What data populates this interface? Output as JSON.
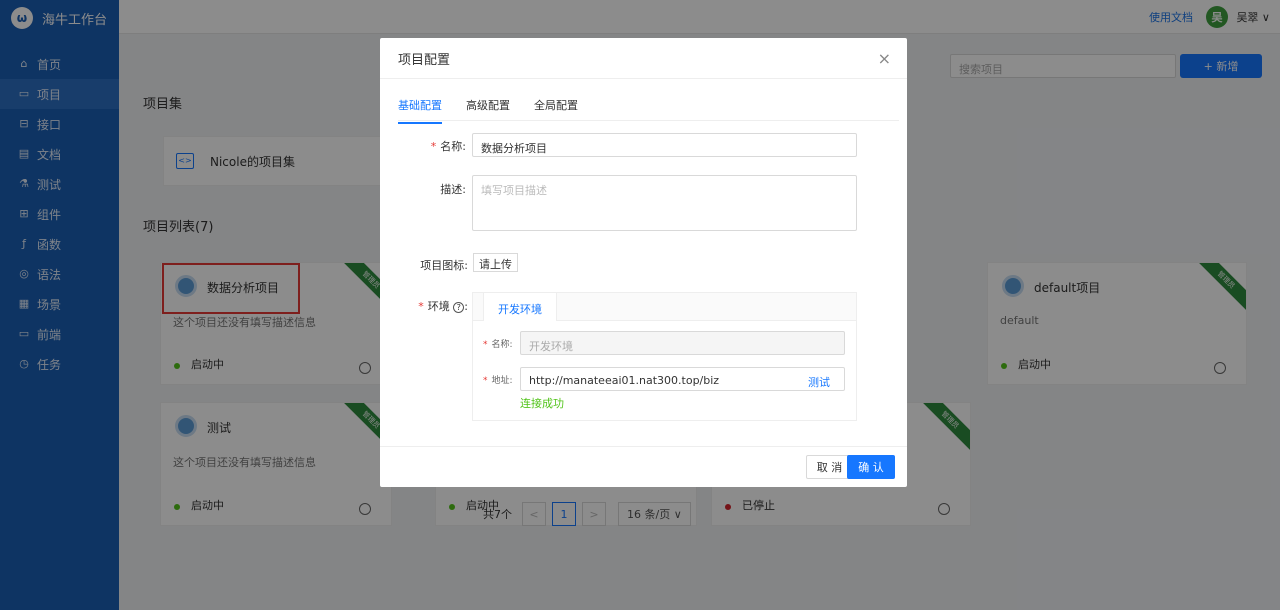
{
  "app": {
    "title": "海牛工作台",
    "logo": "ω"
  },
  "sidebar": {
    "items": [
      {
        "label": "首页",
        "icon": "home-icon",
        "glyph": "⌂",
        "active": false
      },
      {
        "label": "项目",
        "icon": "project-icon",
        "glyph": "▭",
        "active": true
      },
      {
        "label": "接口",
        "icon": "api-icon",
        "glyph": "⊟",
        "active": false
      },
      {
        "label": "文档",
        "icon": "doc-icon",
        "glyph": "▤",
        "active": false
      },
      {
        "label": "测试",
        "icon": "test-icon",
        "glyph": "⚗",
        "active": false
      },
      {
        "label": "组件",
        "icon": "component-icon",
        "glyph": "⊞",
        "active": false
      },
      {
        "label": "函数",
        "icon": "function-icon",
        "glyph": "ƒ",
        "active": false
      },
      {
        "label": "语法",
        "icon": "syntax-icon",
        "glyph": "◎",
        "active": false
      },
      {
        "label": "场景",
        "icon": "scene-icon",
        "glyph": "▦",
        "active": false
      },
      {
        "label": "前端",
        "icon": "frontend-icon",
        "glyph": "▭",
        "active": false
      },
      {
        "label": "任务",
        "icon": "task-icon",
        "glyph": "◷",
        "active": false
      }
    ]
  },
  "header": {
    "doc_link": "使用文档",
    "avatar_text": "吴",
    "user_name": "吴翠 ∨"
  },
  "page": {
    "section_collection": "项目集",
    "collection_name": "Nicole的项目集",
    "section_list": "项目列表(7)",
    "search_placeholder": "搜索项目",
    "new_button": "+ 新增"
  },
  "cards": [
    {
      "name": "数据分析项目",
      "desc": "这个项目还没有填写描述信息",
      "status": "启动中",
      "status_color": "#52c41a",
      "ribbon": "管理员"
    },
    {
      "name": "default项目",
      "desc": "default",
      "status": "启动中",
      "status_color": "#52c41a",
      "ribbon": "管理员"
    },
    {
      "name": "测试",
      "desc": "这个项目还没有填写描述信息",
      "status": "启动中",
      "status_color": "#52c41a",
      "ribbon": "管理员"
    },
    {
      "name": "",
      "desc": "",
      "status": "启动中",
      "status_color": "#52c41a"
    },
    {
      "name": "",
      "desc": "",
      "status": "已停止",
      "status_color": "#d4242c",
      "ribbon": "管理员"
    }
  ],
  "pagination": {
    "total": "共7个",
    "prev": "<",
    "current": "1",
    "next": ">",
    "page_size": "16 条/页 ∨"
  },
  "modal": {
    "title": "项目配置",
    "close": "×",
    "tabs": [
      "基础配置",
      "高级配置",
      "全局配置"
    ],
    "active_tab": 0,
    "name_label": "名称:",
    "name_value": "数据分析项目",
    "desc_label": "描述:",
    "desc_placeholder": "填写项目描述",
    "icon_label": "项目图标:",
    "upload_button": "请上传",
    "env_label": "环境",
    "env_help": "?",
    "env_colon": ":",
    "env_tab": "开发环境",
    "env_name_label": "名称:",
    "env_name_value": "开发环境",
    "env_addr_label": "地址:",
    "env_addr_value": "http://manateeai01.nat300.top/biz",
    "test_button": "测试",
    "connection_status": "连接成功",
    "cancel_button": "取 消",
    "ok_button": "确 认"
  },
  "colors": {
    "sidebar": "#1a5fb4",
    "primary": "#1677ff",
    "success": "#52c41a",
    "danger": "#d4242c",
    "ribbon": "#2f8a3e",
    "highlight": "#e53935"
  }
}
